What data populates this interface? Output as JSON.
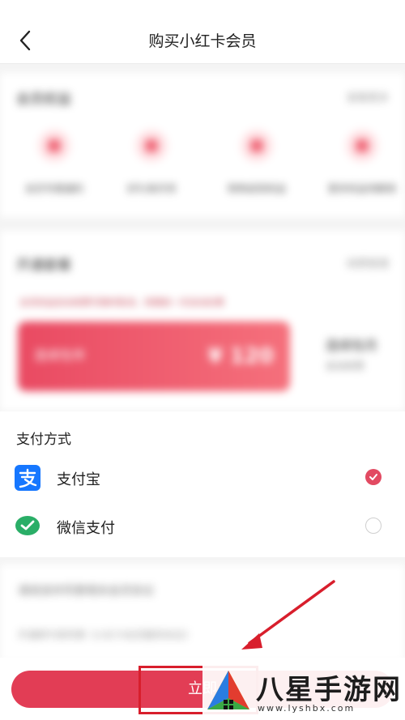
{
  "header": {
    "title": "购买小红卡会员"
  },
  "benefits": {
    "title": "会员权益",
    "more": "查看更多",
    "items": [
      {
        "label": "会员专属福利"
      },
      {
        "label": "好礼每月领"
      },
      {
        "label": "购物返现权益"
      },
      {
        "label": "更多权益待解锁"
      }
    ]
  },
  "plans": {
    "title": "开通套餐",
    "more": "续费管理",
    "notice": "会员权益自动续费可随时取消，到期前一天自动扣费",
    "selected": {
      "tag": "连续包年",
      "amount": "¥ 120"
    },
    "side_title": "连续包月",
    "side_sub": "自动续费"
  },
  "payment": {
    "title": "支付方式",
    "options": [
      {
        "label": "支付宝",
        "icon": "alipay-icon",
        "selected": true
      },
      {
        "label": "微信支付",
        "icon": "wechat-pay-icon",
        "selected": false
      }
    ]
  },
  "agreement": {
    "title": "请阅读并同意相关会员协议",
    "note": "开通即代表同意《小红卡会员服务协议》"
  },
  "bottom": {
    "buy_label": "立即"
  },
  "watermark": {
    "text": "八星手游网",
    "url": "www.lyshbx.com"
  },
  "colors": {
    "accent": "#e23d55",
    "alipay": "#1677ff",
    "wechat": "#2aae67",
    "annotation": "#d81e2c"
  }
}
